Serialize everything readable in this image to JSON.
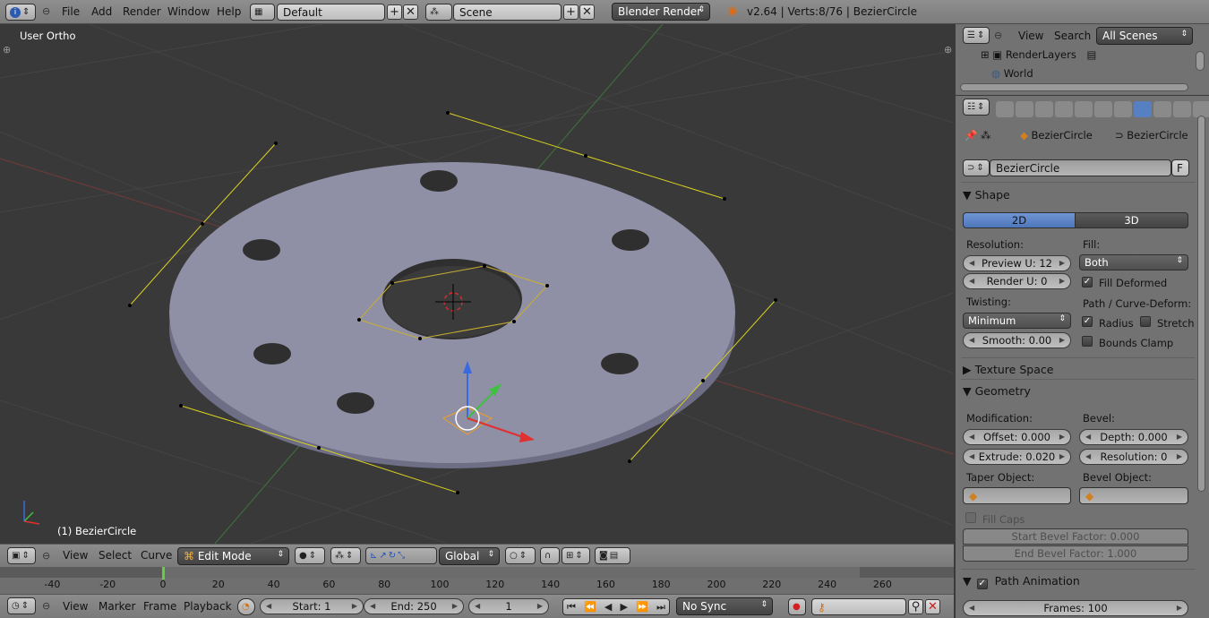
{
  "topbar": {
    "menus": [
      "File",
      "Add",
      "Render",
      "Window",
      "Help"
    ],
    "screen_layout": "Default",
    "scene": "Scene",
    "render_engine": "Blender Render",
    "stats": "v2.64 | Verts:8/76 | BezierCircle"
  },
  "viewport": {
    "view_label": "User Ortho",
    "object_label": "(1) BezierCircle"
  },
  "vp_header": {
    "menus": [
      "View",
      "Select",
      "Curve"
    ],
    "mode": "Edit Mode",
    "orientation": "Global"
  },
  "timeline": {
    "ticks": [
      -40,
      -20,
      0,
      20,
      40,
      60,
      80,
      100,
      120,
      140,
      160,
      180,
      200,
      220,
      240,
      260
    ],
    "current_frame_marker": 0,
    "menus": [
      "View",
      "Marker",
      "Frame",
      "Playback"
    ],
    "start": "Start: 1",
    "end": "End: 250",
    "current": "1",
    "sync": "No Sync"
  },
  "outliner": {
    "menus": [
      "View",
      "Search"
    ],
    "filter": "All Scenes",
    "items": [
      "RenderLayers",
      "World"
    ]
  },
  "properties": {
    "breadcrumb_object": "BezierCircle",
    "breadcrumb_data": "BezierCircle",
    "datablock_name": "BezierCircle",
    "datablock_f": "F",
    "shape": {
      "header": "Shape",
      "tab_2d": "2D",
      "tab_3d": "3D",
      "resolution_label": "Resolution:",
      "preview_u": "Preview U: 12",
      "render_u": "Render U: 0",
      "twisting_label": "Twisting:",
      "twisting_value": "Minimum",
      "smooth": "Smooth: 0.00",
      "fill_label": "Fill:",
      "fill_value": "Both",
      "fill_deformed": "Fill Deformed",
      "path_label": "Path / Curve-Deform:",
      "radius": "Radius",
      "stretch": "Stretch",
      "bounds_clamp": "Bounds Clamp"
    },
    "texture_space_header": "Texture Space",
    "geometry": {
      "header": "Geometry",
      "modification_label": "Modification:",
      "offset": "Offset: 0.000",
      "extrude": "Extrude: 0.020",
      "bevel_label": "Bevel:",
      "depth": "Depth: 0.000",
      "resolution": "Resolution: 0",
      "taper_label": "Taper Object:",
      "bevel_obj_label": "Bevel Object:",
      "fill_caps": "Fill Caps",
      "start_bevel": "Start Bevel Factor: 0.000",
      "end_bevel": "End Bevel Factor: 1.000"
    },
    "path_animation": {
      "header": "Path Animation",
      "frames": "Frames: 100"
    }
  },
  "colors": {
    "header_bg": "#858585",
    "viewport_bg": "#393939",
    "panel_bg": "#727272",
    "active_blue": "#5680c2",
    "mesh_fill": "#8e8ea6",
    "selection_yellow": "#d8d020"
  }
}
